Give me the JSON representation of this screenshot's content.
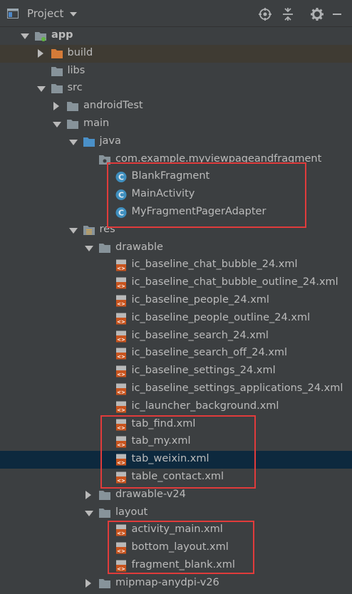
{
  "header": {
    "title": "Project"
  },
  "tree": [
    {
      "label": "app",
      "icon": "module-icon",
      "arrow": "down",
      "indent": 0,
      "bold": true
    },
    {
      "label": "build",
      "icon": "folder-orange-icon",
      "arrow": "right",
      "indent": 1,
      "highlight": true
    },
    {
      "label": "libs",
      "icon": "folder-icon",
      "arrow": "none",
      "indent": 1
    },
    {
      "label": "src",
      "icon": "folder-icon",
      "arrow": "down",
      "indent": 1
    },
    {
      "label": "androidTest",
      "icon": "folder-icon",
      "arrow": "right",
      "indent": 2
    },
    {
      "label": "main",
      "icon": "folder-icon",
      "arrow": "down",
      "indent": 2
    },
    {
      "label": "java",
      "icon": "folder-blue-icon",
      "arrow": "down",
      "indent": 3
    },
    {
      "label": "com.example.myviewpageandfragment",
      "icon": "package-icon",
      "arrow": "none",
      "indent": 4
    },
    {
      "label": "BlankFragment",
      "icon": "class-icon",
      "arrow": "none",
      "indent": 5
    },
    {
      "label": "MainActivity",
      "icon": "class-icon",
      "arrow": "none",
      "indent": 5
    },
    {
      "label": "MyFragmentPagerAdapter",
      "icon": "class-icon",
      "arrow": "none",
      "indent": 5
    },
    {
      "label": "res",
      "icon": "res-folder-icon",
      "arrow": "down",
      "indent": 3
    },
    {
      "label": "drawable",
      "icon": "folder-icon",
      "arrow": "down",
      "indent": 4
    },
    {
      "label": "ic_baseline_chat_bubble_24.xml",
      "icon": "xml-file-icon",
      "arrow": "none",
      "indent": 5
    },
    {
      "label": "ic_baseline_chat_bubble_outline_24.xml",
      "icon": "xml-file-icon",
      "arrow": "none",
      "indent": 5
    },
    {
      "label": "ic_baseline_people_24.xml",
      "icon": "xml-file-icon",
      "arrow": "none",
      "indent": 5
    },
    {
      "label": "ic_baseline_people_outline_24.xml",
      "icon": "xml-file-icon",
      "arrow": "none",
      "indent": 5
    },
    {
      "label": "ic_baseline_search_24.xml",
      "icon": "xml-file-icon",
      "arrow": "none",
      "indent": 5
    },
    {
      "label": "ic_baseline_search_off_24.xml",
      "icon": "xml-file-icon",
      "arrow": "none",
      "indent": 5
    },
    {
      "label": "ic_baseline_settings_24.xml",
      "icon": "xml-file-icon",
      "arrow": "none",
      "indent": 5
    },
    {
      "label": "ic_baseline_settings_applications_24.xml",
      "icon": "xml-file-icon",
      "arrow": "none",
      "indent": 5
    },
    {
      "label": "ic_launcher_background.xml",
      "icon": "xml-file-icon",
      "arrow": "none",
      "indent": 5
    },
    {
      "label": "tab_find.xml",
      "icon": "xml-file-icon",
      "arrow": "none",
      "indent": 5
    },
    {
      "label": "tab_my.xml",
      "icon": "xml-file-icon",
      "arrow": "none",
      "indent": 5
    },
    {
      "label": "tab_weixin.xml",
      "icon": "xml-file-icon",
      "arrow": "none",
      "indent": 5,
      "selected": true
    },
    {
      "label": "table_contact.xml",
      "icon": "xml-file-icon",
      "arrow": "none",
      "indent": 5
    },
    {
      "label": "drawable-v24",
      "icon": "folder-icon",
      "arrow": "right",
      "indent": 4
    },
    {
      "label": "layout",
      "icon": "folder-icon",
      "arrow": "down",
      "indent": 4
    },
    {
      "label": "activity_main.xml",
      "icon": "xml-file-icon",
      "arrow": "none",
      "indent": 5
    },
    {
      "label": "bottom_layout.xml",
      "icon": "xml-file-icon",
      "arrow": "none",
      "indent": 5
    },
    {
      "label": "fragment_blank.xml",
      "icon": "xml-file-icon",
      "arrow": "none",
      "indent": 5
    },
    {
      "label": "mipmap-anydpi-v26",
      "icon": "folder-icon",
      "arrow": "right",
      "indent": 4
    }
  ],
  "colors": {
    "background": "#3c3f41",
    "selected": "#0d293e",
    "annotation": "#e03b3b",
    "text": "#bbbbbb"
  }
}
